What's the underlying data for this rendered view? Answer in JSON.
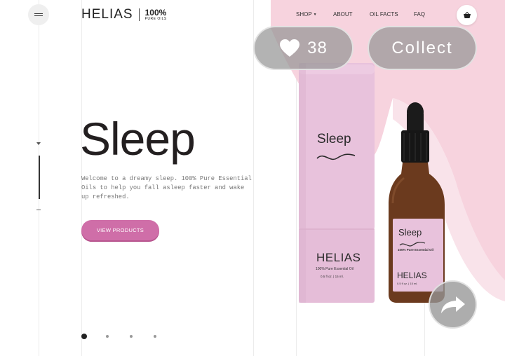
{
  "brand": {
    "name": "HELIAS",
    "badge_percent": "100%",
    "badge_text": "PURE OILS"
  },
  "nav": {
    "items": [
      {
        "label": "SHOP",
        "has_dropdown": true
      },
      {
        "label": "ABOUT",
        "has_dropdown": false
      },
      {
        "label": "OIL FACTS",
        "has_dropdown": false
      },
      {
        "label": "FAQ",
        "has_dropdown": false
      }
    ]
  },
  "overlay": {
    "like_count": "38",
    "collect_label": "Collect"
  },
  "hero": {
    "title": "Sleep",
    "description": "Welcome to a dreamy sleep. 100% Pure Essential Oils to help you fall asleep faster and wake up refreshed.",
    "cta_label": "VIEW PRODUCTS"
  },
  "product": {
    "tube_label": "Sleep",
    "tube_brand": "HELIAS",
    "tube_subtitle": "100% Pure Essential Oil",
    "tube_volume": "0.5 fl oz. | 15 ml.",
    "bottle_label": "Sleep",
    "bottle_subtitle": "100% Pure Essential Oil",
    "bottle_brand": "HELIAS",
    "bottle_volume": "0.5 fl oz. | 15 ml."
  },
  "slider": {
    "total_slides": 4,
    "active_index": 0
  },
  "colors": {
    "accent_pink": "#cf6ea8",
    "background_pink": "#f7d3de",
    "tube_pink": "#e8c2dc",
    "bottle_amber": "#6b3a1e",
    "overlay_gray": "#969696"
  },
  "icons": {
    "menu": "hamburger-icon",
    "cart": "basket-icon",
    "like": "heart-icon",
    "share": "share-arrow-icon"
  }
}
